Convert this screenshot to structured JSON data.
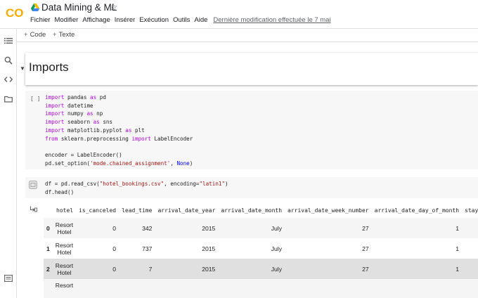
{
  "app": {
    "title": "Data Mining & ML",
    "logo_text": "CO",
    "brand_color": "#f9ab00"
  },
  "menu": {
    "items": [
      "Fichier",
      "Modifier",
      "Affichage",
      "Insérer",
      "Exécution",
      "Outils",
      "Aide"
    ],
    "last_edit": "Dernière modification effectuée le 7 mai"
  },
  "toolbar": {
    "code_label": "Code",
    "text_label": "Texte"
  },
  "rail": {
    "icons": [
      "toc-icon",
      "search-icon",
      "code-snippets-icon",
      "folder-icon",
      "terminal-icon"
    ]
  },
  "section": {
    "title": "Imports"
  },
  "cell1": {
    "run_label": "[ ]",
    "lines": [
      [
        [
          "kw",
          "import"
        ],
        [
          "t",
          " pandas "
        ],
        [
          "kw",
          "as"
        ],
        [
          "t",
          " pd"
        ]
      ],
      [
        [
          "kw",
          "import"
        ],
        [
          "t",
          " datetime"
        ]
      ],
      [
        [
          "kw",
          "import"
        ],
        [
          "t",
          " numpy "
        ],
        [
          "kw",
          "as"
        ],
        [
          "t",
          " np"
        ]
      ],
      [
        [
          "kw",
          "import"
        ],
        [
          "t",
          " seaborn "
        ],
        [
          "kw",
          "as"
        ],
        [
          "t",
          " sns"
        ]
      ],
      [
        [
          "kw",
          "import"
        ],
        [
          "t",
          " matplotlib.pyplot "
        ],
        [
          "kw",
          "as"
        ],
        [
          "t",
          " plt"
        ]
      ],
      [
        [
          "kw",
          "from"
        ],
        [
          "t",
          " sklearn.preprocessing "
        ],
        [
          "kw",
          "import"
        ],
        [
          "t",
          " LabelEncoder"
        ]
      ],
      [],
      [
        [
          "t",
          "encoder = LabelEncoder()"
        ]
      ],
      [
        [
          "t",
          "pd.set_option("
        ],
        [
          "str",
          "'mode.chained_assignment'"
        ],
        [
          "t",
          ", "
        ],
        [
          "cst",
          "None"
        ],
        [
          "t",
          ")"
        ]
      ]
    ]
  },
  "cell2": {
    "lines": [
      [
        [
          "t",
          "df = pd.read_csv("
        ],
        [
          "str",
          "\"hotel_bookings.csv\""
        ],
        [
          "t",
          ", encoding="
        ],
        [
          "str",
          "\"latin1\""
        ],
        [
          "t",
          ")"
        ]
      ],
      [
        [
          "t",
          "df.head()"
        ]
      ]
    ]
  },
  "table": {
    "columns": [
      "",
      "hotel",
      "is_canceled",
      "lead_time",
      "arrival_date_year",
      "arrival_date_month",
      "arrival_date_week_number",
      "arrival_date_day_of_month",
      "stays"
    ],
    "rows": [
      {
        "idx": "0",
        "hotel1": "Resort",
        "hotel2": "Hotel",
        "is_canceled": "0",
        "lead_time": "342",
        "year": "2015",
        "month": "July",
        "week": "27",
        "day": "1"
      },
      {
        "idx": "1",
        "hotel1": "Resort",
        "hotel2": "Hotel",
        "is_canceled": "0",
        "lead_time": "737",
        "year": "2015",
        "month": "July",
        "week": "27",
        "day": "1"
      },
      {
        "idx": "2",
        "hotel1": "Resort",
        "hotel2": "Hotel",
        "is_canceled": "0",
        "lead_time": "7",
        "year": "2015",
        "month": "July",
        "week": "27",
        "day": "1"
      },
      {
        "idx": "",
        "hotel1": "Resort",
        "hotel2": "",
        "is_canceled": "",
        "lead_time": "",
        "year": "",
        "month": "",
        "week": "",
        "day": ""
      }
    ]
  }
}
